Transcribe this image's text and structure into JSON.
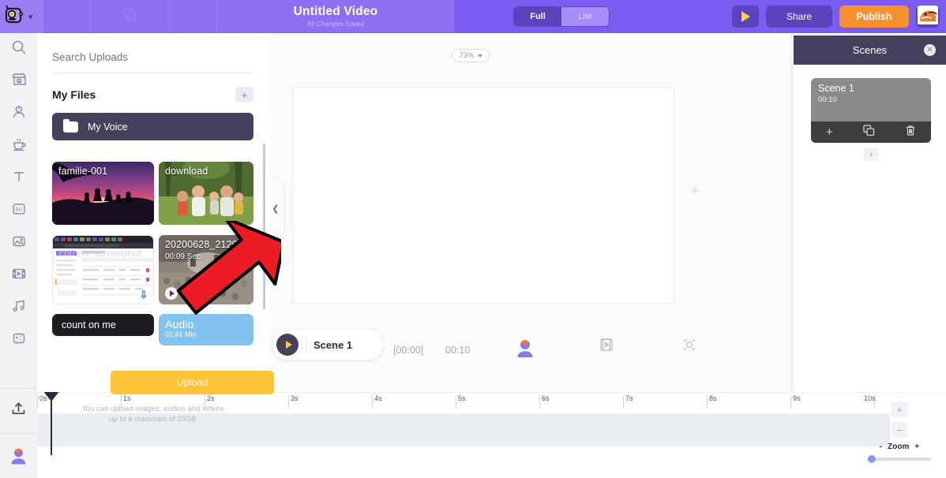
{
  "header": {
    "logo_icon": "robot-logo-icon",
    "caret_icon": "chevron-down-icon",
    "duplicate_icon": "duplicate-icon",
    "title": "Untitled Video",
    "subtitle": "All Changes Saved",
    "mode_toggle": {
      "full": "Full",
      "lite": "Lite",
      "selected": "Full"
    },
    "play_icon": "play-icon",
    "share_label": "Share",
    "publish_label": "Publish",
    "avatar_icon": "mascot-avatar-icon",
    "bg_color": "#7a5cf0",
    "publish_color": "#f6912e"
  },
  "rail": {
    "items": [
      {
        "icon": "search-icon"
      },
      {
        "icon": "clapperboard-icon"
      },
      {
        "icon": "character-icon"
      },
      {
        "icon": "props-coffee-icon"
      },
      {
        "icon": "text-icon",
        "glyph": "T"
      },
      {
        "icon": "background-icon",
        "glyph": "BG"
      },
      {
        "icon": "image-icon"
      },
      {
        "icon": "video-icon"
      },
      {
        "icon": "music-icon"
      },
      {
        "icon": "effects-icon"
      }
    ],
    "upload_icon": "upload-icon",
    "user_icon": "user-avatar-icon"
  },
  "uploads_panel": {
    "search_placeholder": "Search Uploads",
    "search_value": "",
    "files_title": "My Files",
    "add_folder_icon": "plus-icon",
    "folder": {
      "icon": "folder-icon",
      "name": "My Voice"
    },
    "thumbnails": [
      {
        "name": "familie-001",
        "sub": "",
        "type": "image"
      },
      {
        "name": "download",
        "sub": "",
        "type": "image"
      },
      {
        "name": "chrome screenshot",
        "sub": "",
        "type": "image"
      },
      {
        "name": "20200628_212934",
        "sub": "00:09 Sec",
        "type": "video"
      },
      {
        "name": "count on me",
        "sub": "",
        "type": "audio"
      },
      {
        "name": "Audio",
        "sub": "01:41 Min",
        "type": "audio"
      }
    ],
    "upload_label": "Upload",
    "upload_hint_line1": "You can upload images, audios and videos",
    "upload_hint_line2": "up to a maximum of 25GB",
    "collapse_icon": "chevron-left-icon"
  },
  "canvas": {
    "zoom_value": "73%",
    "zoom_caret_icon": "chevron-down-icon",
    "add_icon": "plus-icon"
  },
  "scene_toolbar": {
    "play_icon": "play-icon",
    "scene_label": "Scene 1",
    "current_time": "[00:00]",
    "duration": "00:10",
    "character_icon": "character-avatar-icon",
    "media_icon": "film-strip-icon",
    "transition_icon": "transition-icon"
  },
  "scenes_panel": {
    "title": "Scenes",
    "close_icon": "close-icon",
    "scene": {
      "title": "Scene 1",
      "duration": "00:10",
      "actions": [
        {
          "icon": "plus-icon"
        },
        {
          "icon": "duplicate-icon"
        },
        {
          "icon": "trash-icon"
        }
      ]
    },
    "add_scene_icon": "plus-icon"
  },
  "timeline": {
    "ticks": [
      "0s",
      "1s",
      "2s",
      "3s",
      "4s",
      "5s",
      "6s",
      "7s",
      "8s",
      "9s",
      "10s"
    ],
    "playhead_position": "0s",
    "zoom_in_icon": "plus-icon",
    "zoom_out_icon": "minus-icon",
    "zoom_minus_label": "-",
    "zoom_label": "Zoom",
    "zoom_plus_label": "+"
  },
  "annotation": {
    "arrow_icon": "red-arrow-icon",
    "color": "#ec1c24"
  }
}
